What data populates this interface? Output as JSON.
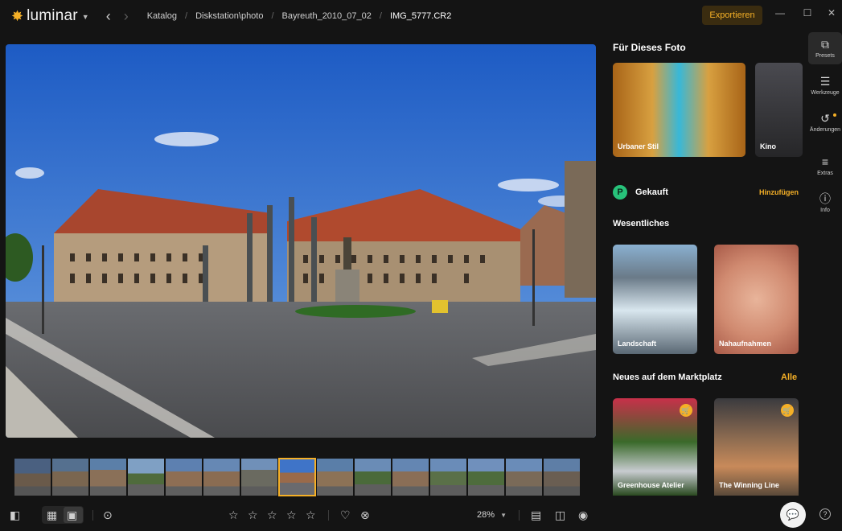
{
  "app": {
    "name": "luminar"
  },
  "breadcrumb": [
    "Katalog",
    "Diskstation\\photo",
    "Bayreuth_2010_07_02",
    "IMG_5777.CR2"
  ],
  "toolbar": {
    "export_label": "Exportieren"
  },
  "window": {
    "minimize": "—",
    "maximize": "☐",
    "close": "✕"
  },
  "bottom": {
    "zoom": "28%"
  },
  "panel": {
    "for_photo_title": "Für Dieses Foto",
    "presets": [
      {
        "label": "Urbaner Stil"
      },
      {
        "label": "Kino"
      }
    ],
    "purchased": {
      "label": "Gekauft",
      "action": "Hinzufügen"
    },
    "essentials_title": "Wesentliches",
    "essentials": [
      {
        "label": "Landschaft"
      },
      {
        "label": "Nahaufnahmen"
      }
    ],
    "market_title": "Neues auf dem Marktplatz",
    "market_action": "Alle",
    "market": [
      {
        "label": "Greenhouse Atelier"
      },
      {
        "label": "The Winning Line"
      }
    ]
  },
  "sidenav": [
    {
      "label": "Presets",
      "icon": "presets-icon",
      "active": true
    },
    {
      "label": "Werkzeuge",
      "icon": "sliders-icon",
      "active": false
    },
    {
      "label": "Änderungen",
      "icon": "history-icon",
      "active": false
    },
    {
      "label": "Extras",
      "icon": "list-icon",
      "active": false
    },
    {
      "label": "Info",
      "icon": "info-icon",
      "active": false
    }
  ],
  "colors": {
    "accent": "#f5b027",
    "background": "#141414",
    "purchased": "#27c27a"
  }
}
